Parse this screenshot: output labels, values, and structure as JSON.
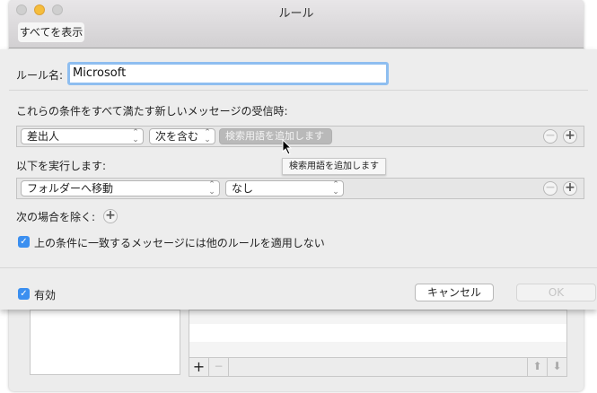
{
  "window": {
    "title": "ルール",
    "show_all": "すべてを表示"
  },
  "rule_name": {
    "label": "ルール名:",
    "value": "Microsoft"
  },
  "conditions": {
    "label": "これらの条件をすべて満たす新しいメッセージの受信時:",
    "field": "差出人",
    "operator": "次を含む",
    "value_placeholder": "検索用語を追加します"
  },
  "tooltip": "検索用語を追加します",
  "actions": {
    "label": "以下を実行します:",
    "action": "フォルダーへ移動",
    "target": "なし"
  },
  "exceptions": {
    "label": "次の場合を除く:"
  },
  "stop_rules": {
    "label": "上の条件に一致するメッセージには他のルールを適用しない",
    "checked": true
  },
  "enabled": {
    "label": "有効",
    "checked": true
  },
  "buttons": {
    "cancel": "キャンセル",
    "ok": "OK"
  },
  "icons": {
    "check": "✓",
    "plus": "+",
    "minus": "−",
    "up": "⬆",
    "down": "⬇",
    "updown": "⌃⌄"
  }
}
